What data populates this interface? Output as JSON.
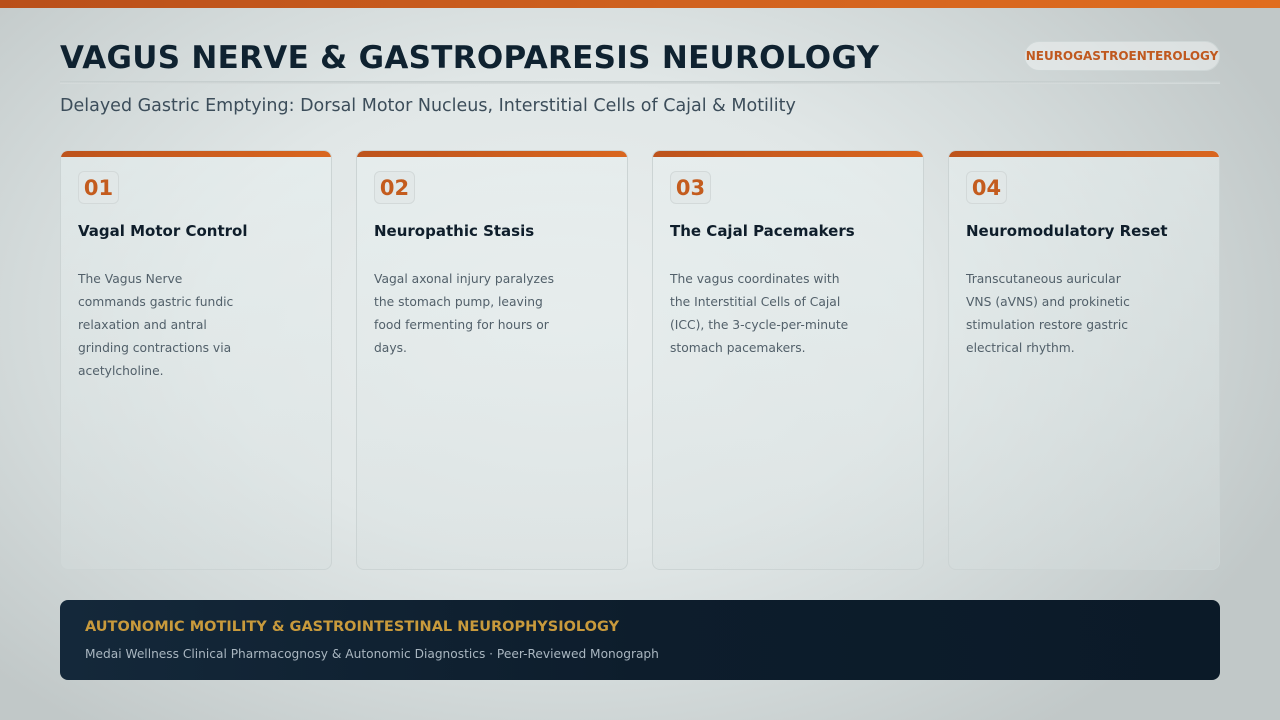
{
  "header": {
    "title": "VAGUS NERVE & GASTROPARESIS NEUROLOGY",
    "badge": "NEUROGASTROENTEROLOGY",
    "subtitle": "Delayed Gastric Emptying: Dorsal Motor Nucleus, Interstitial Cells of Cajal & Motility"
  },
  "cards": [
    {
      "number": "01",
      "title": "Vagal Motor Control",
      "body": "The Vagus Nerve commands gastric fundic relaxation and antral grinding contractions via acetylcholine."
    },
    {
      "number": "02",
      "title": "Neuropathic Stasis",
      "body": "Vagal axonal injury paralyzes the stomach pump, leaving food fermenting for hours or days."
    },
    {
      "number": "03",
      "title": "The Cajal Pacemakers",
      "body": "The vagus coordinates with the Interstitial Cells of Cajal (ICC), the 3-cycle-per-minute stomach pacemakers."
    },
    {
      "number": "04",
      "title": "Neuromodulatory Reset",
      "body": "Transcutaneous auricular VNS (aVNS) and prokinetic stimulation restore gastric electrical rhythm."
    }
  ],
  "footer": {
    "title": "AUTONOMIC MOTILITY & GASTROINTESTINAL NEUROPHYSIOLOGY",
    "subtitle": "Medai Wellness Clinical Pharmacognosy & Autonomic Diagnostics · Peer-Reviewed Monograph"
  },
  "colors": {
    "accent": "#d1621f",
    "title": "#0f2230",
    "footer_bg": "#0d1d2c",
    "footer_title": "#c89a3c"
  }
}
